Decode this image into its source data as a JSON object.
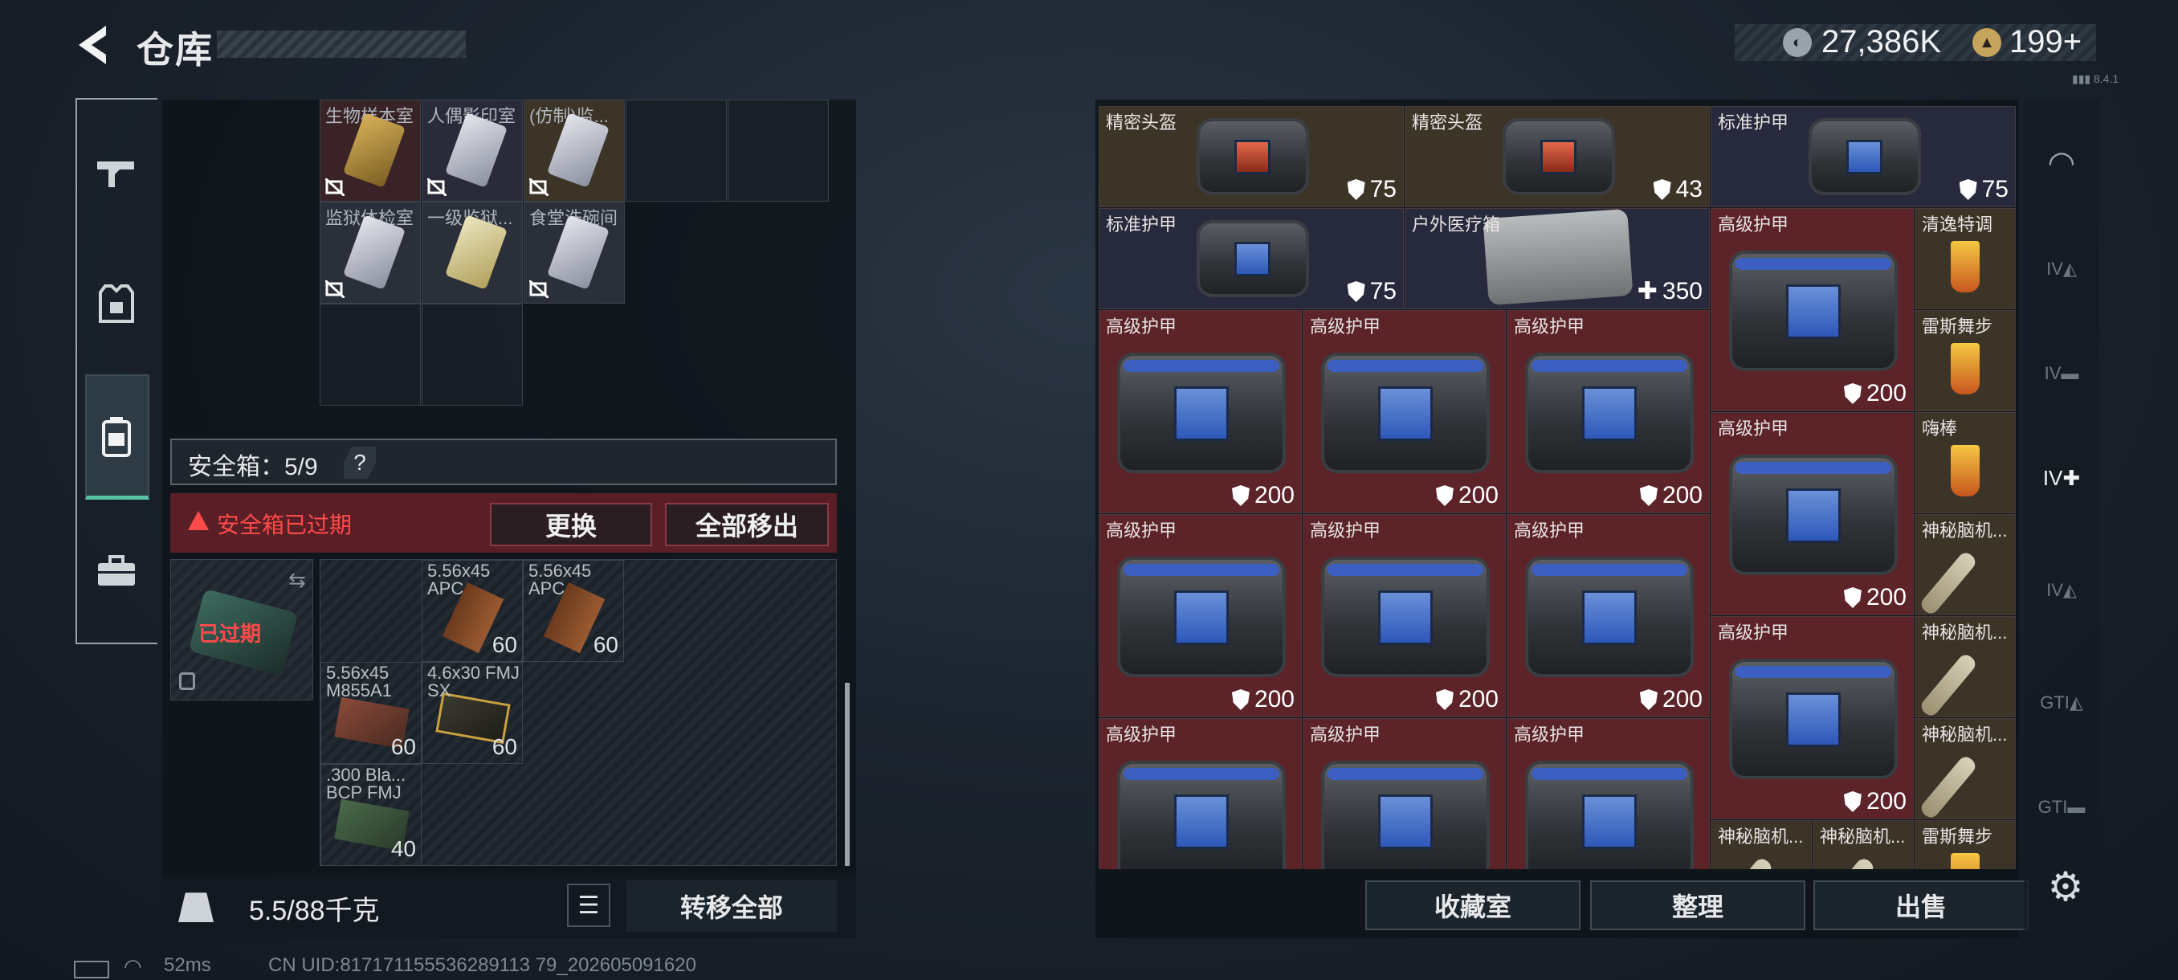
{
  "header": {
    "title": "仓库",
    "currency_main": "27,386K",
    "currency_premium": "199+",
    "version": "▮▮▮ 8.4.1"
  },
  "left_rail": {
    "items": [
      "weapons",
      "armor",
      "backpack",
      "case"
    ]
  },
  "storage_grid": {
    "items": [
      {
        "label": "生物样本室"
      },
      {
        "label": "人偶影印室"
      },
      {
        "label": "(仿制)监..."
      },
      {
        "label": "监狱体检室"
      },
      {
        "label": "一级监狱..."
      },
      {
        "label": "食堂洗碗间"
      }
    ]
  },
  "safe_box": {
    "label": "安全箱：5/9",
    "help": "?",
    "expired_message": "安全箱已过期",
    "replace_btn": "更换",
    "move_all_btn": "全部移出",
    "case_status": "已过期"
  },
  "ammo": [
    {
      "label": "5.56x45 APC",
      "count": "60"
    },
    {
      "label": "5.56x45 APC",
      "count": "60"
    },
    {
      "label": "5.56x45 M855A1",
      "count": "60"
    },
    {
      "label": "4.6x30 FMJ SX",
      "count": "60"
    },
    {
      "label": ".300 Bla... BCP FMJ",
      "count": "40"
    }
  ],
  "footer_left": {
    "weight": "5.5/88千克",
    "transfer_all": "转移全部"
  },
  "status": {
    "ping": "52ms",
    "uid": "CN UID:817171155536289113 79_202605091620"
  },
  "inventory": [
    {
      "label": "精密头盔",
      "value": "75"
    },
    {
      "label": "精密头盔",
      "value": "43"
    },
    {
      "label": "标准护甲",
      "value": "75"
    },
    {
      "label": "标准护甲",
      "value": "75"
    },
    {
      "label": "户外医疗箱",
      "value": "350"
    },
    {
      "label": "高级护甲",
      "value": "200"
    },
    {
      "label": "清逸特调",
      "value": ""
    },
    {
      "label": "高级护甲",
      "value": "200"
    },
    {
      "label": "高级护甲",
      "value": "200"
    },
    {
      "label": "高级护甲",
      "value": "200"
    },
    {
      "label": "雷斯舞步",
      "value": ""
    },
    {
      "label": "高级护甲",
      "value": "200"
    },
    {
      "label": "嗨棒",
      "value": ""
    },
    {
      "label": "高级护甲",
      "value": "200"
    },
    {
      "label": "高级护甲",
      "value": "200"
    },
    {
      "label": "高级护甲",
      "value": "200"
    },
    {
      "label": "高级护甲",
      "value": "200"
    },
    {
      "label": "神秘脑机...",
      "value": ""
    },
    {
      "label": "高级护甲",
      "value": "200"
    },
    {
      "label": "神秘脑机...",
      "value": ""
    },
    {
      "label": "高级护甲",
      "value": ""
    },
    {
      "label": "高级护甲",
      "value": ""
    },
    {
      "label": "高级护甲",
      "value": ""
    },
    {
      "label": "神秘脑机...",
      "value": ""
    },
    {
      "label": "神秘脑机...",
      "value": ""
    },
    {
      "label": "神秘脑机...",
      "value": ""
    },
    {
      "label": "雷斯舞步",
      "value": ""
    }
  ],
  "bottom_buttons": {
    "collection": "收藏室",
    "sort": "整理",
    "sell": "出售"
  },
  "right_rail": {
    "labels": [
      "IV",
      "IV",
      "IV",
      "IV",
      "GTI",
      "GTI"
    ]
  },
  "colors": {
    "accent": "#57c3a4",
    "danger": "#ff4a4a",
    "slot_red": "#5c2329",
    "slot_brown": "#3d3428",
    "slot_blue": "#262a3c"
  }
}
